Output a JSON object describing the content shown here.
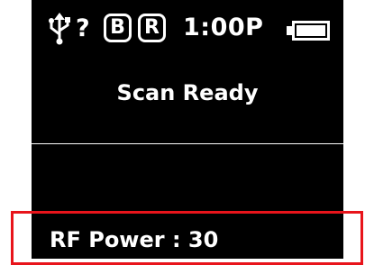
{
  "status_bar": {
    "usb_icon": "usb-icon",
    "unknown_symbol": "?",
    "badge_b": "B",
    "badge_r": "R",
    "time": "1:00P",
    "battery_icon": "battery-full-icon"
  },
  "main": {
    "scan_status": "Scan Ready"
  },
  "footer": {
    "rf_power": "RF Power : 30"
  },
  "colors": {
    "screen_background": "#000000",
    "text": "#ffffff",
    "highlight": "#e8141b"
  }
}
